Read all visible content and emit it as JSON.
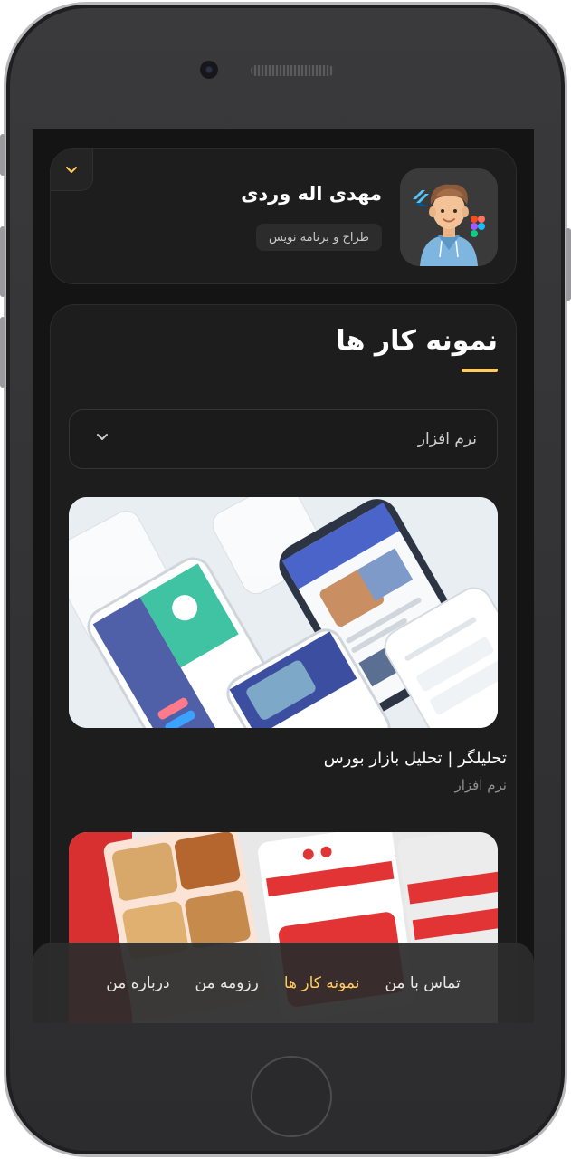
{
  "profile": {
    "name": "مهدی اله وردی",
    "job": "طراح و برنامه نویس",
    "avatar_icon": "developer-avatar-icon",
    "toggle_icon": "chevron-down-icon"
  },
  "portfolio": {
    "title": "نمونه کار ها",
    "filter": {
      "selected": "نرم افزار",
      "icon": "chevron-down-icon"
    },
    "projects": [
      {
        "title": "تحلیلگر | تحلیل بازار بورس",
        "category": "نرم افزار"
      },
      {
        "title": "",
        "category": ""
      }
    ]
  },
  "nav": {
    "items": [
      {
        "label": "درباره من",
        "active": false
      },
      {
        "label": "رزومه من",
        "active": false
      },
      {
        "label": "نمونه کار ها",
        "active": true
      },
      {
        "label": "تماس با من",
        "active": false
      }
    ]
  },
  "colors": {
    "accent": "#ffcb5c",
    "background": "#141414",
    "card": "#1d1d1d"
  }
}
